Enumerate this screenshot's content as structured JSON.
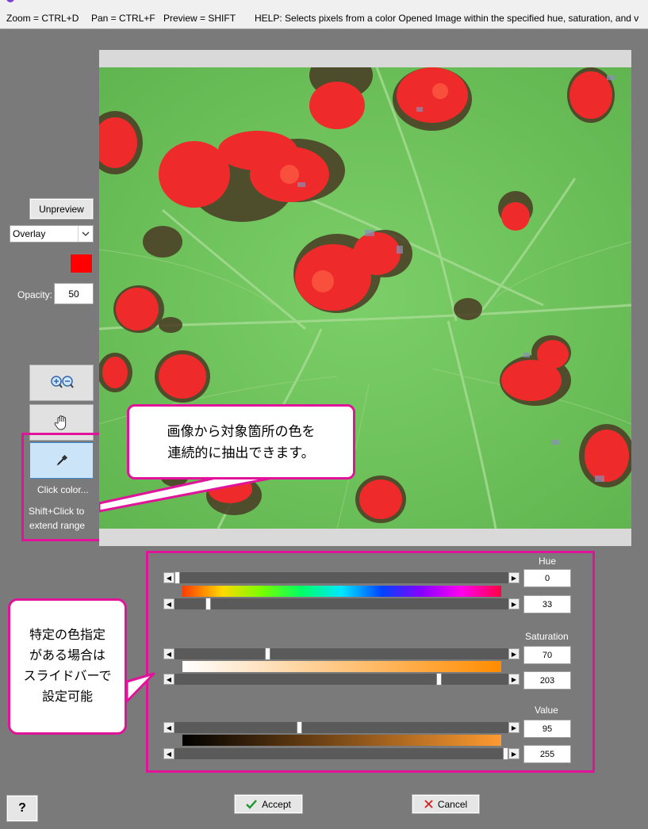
{
  "topbar": {
    "zoom": "Zoom = CTRL+D",
    "pan": "Pan = CTRL+F",
    "preview": "Preview = SHIFT",
    "help": "HELP:  Selects pixels from a color Opened Image within the specified hue, saturation, and v"
  },
  "left_panel": {
    "unpreview_label": "Unpreview",
    "mode_value": "Overlay",
    "overlay_color": "#ff0000",
    "opacity_label": "Opacity:",
    "opacity_value": "50",
    "click_color_label": "Click color...",
    "shift_click_line1": "Shift+Click to",
    "shift_click_line2": "extend range"
  },
  "callouts": {
    "image_line1": "画像から対象箇所の色を",
    "image_line2": "連続的に抽出できます。",
    "slider_line1": "特定の色指定",
    "slider_line2": "がある場合は",
    "slider_line3": "スライドバーで",
    "slider_line4": "設定可能"
  },
  "sliders": {
    "hue": {
      "title": "Hue",
      "min": "0",
      "max": "33",
      "min_frac": 0.0,
      "max_frac": 0.094
    },
    "saturation": {
      "title": "Saturation",
      "min": "70",
      "max": "203",
      "min_frac": 0.275,
      "max_frac": 0.796
    },
    "value": {
      "title": "Value",
      "min": "95",
      "max": "255",
      "min_frac": 0.373,
      "max_frac": 1.0
    }
  },
  "footer": {
    "help_label": "?",
    "accept_label": "Accept",
    "cancel_label": "Cancel"
  },
  "colors": {
    "accent_pink": "#e0139a",
    "leaf_green": "#6dc45a",
    "spot_red": "#ee2a2a"
  }
}
